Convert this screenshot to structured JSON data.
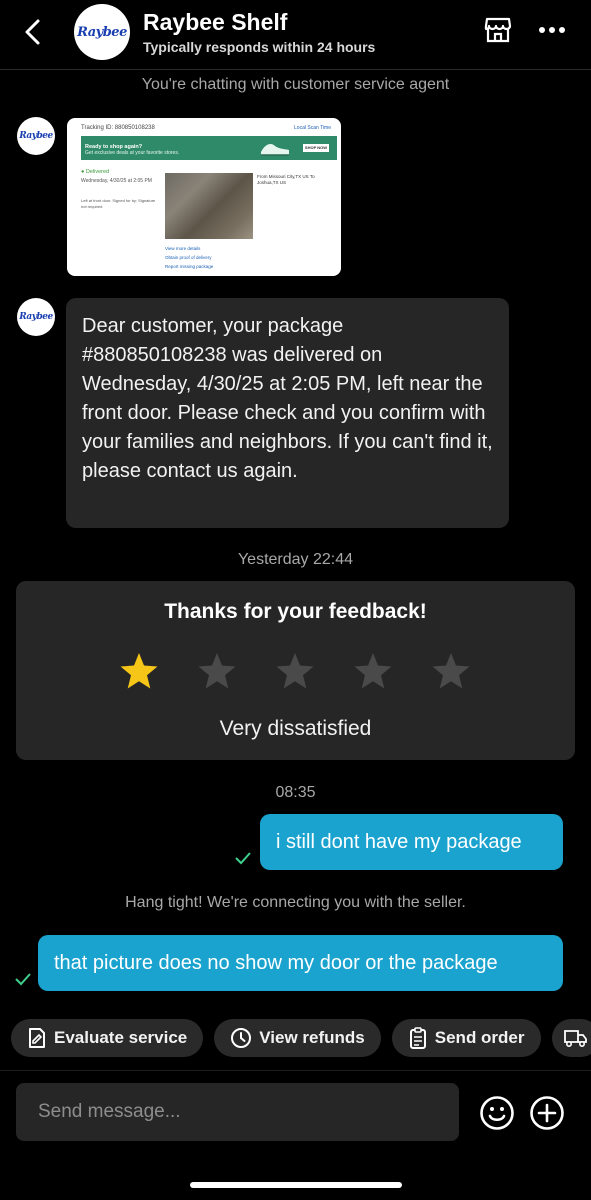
{
  "header": {
    "logo_text": "Raybee",
    "title": "Raybee Shelf",
    "subtitle": "Typically responds within 24 hours",
    "icons": {
      "back": "chevron-left-icon",
      "store": "storefront-icon",
      "more": "more-horizontal-icon"
    }
  },
  "chat": {
    "system_note": "You're chatting with customer service agent",
    "tracking_screenshot": {
      "tracking_label": "Tracking ID: 880850108238",
      "scan_time": "Local Scan Time",
      "banner_title": "Ready to shop again?",
      "banner_sub": "Get exclusive deals at your favorite stores.",
      "banner_button": "SHOP NOW",
      "status": "Delivered",
      "date": "Wednesday, 4/30/25 at 2:05 PM",
      "note": "Left at front door. Signed for by: Signature not required",
      "from_to": "From Missouri City,TX US To Joshua,TX US",
      "links": [
        "View more details",
        "Obtain proof of delivery",
        "Report missing package"
      ]
    },
    "agent_message": "Dear customer, your package #880850108238 was delivered on Wednesday, 4/30/25 at 2:05 PM, left near the front door. Please check and you confirm with your families and neighbors. If you can't find it, please contact us again.",
    "timestamp_1": "Yesterday 22:44",
    "feedback": {
      "title": "Thanks for your feedback!",
      "rating": 1,
      "max_rating": 5,
      "label": "Very dissatisfied",
      "star_active_color": "#f5c518",
      "star_inactive_color": "#4a4a4a"
    },
    "timestamp_2": "08:35",
    "user_message_1": "i still dont have my package",
    "connecting_note": "Hang tight! We're connecting you with the seller.",
    "user_message_2": "that picture does no show my door or the package"
  },
  "quick_actions": [
    {
      "label": "Evaluate service",
      "icon": "edit-document-icon"
    },
    {
      "label": "View refunds",
      "icon": "clock-icon"
    },
    {
      "label": "Send order",
      "icon": "clipboard-icon"
    },
    {
      "label": "",
      "icon": "truck-icon"
    }
  ],
  "composer": {
    "placeholder": "Send message...",
    "icons": {
      "emoji": "emoji-icon",
      "add": "plus-circle-icon"
    }
  },
  "colors": {
    "accent": "#1ba3cf",
    "background": "#000000",
    "bubble": "#262626",
    "check": "#3ecf8e"
  }
}
